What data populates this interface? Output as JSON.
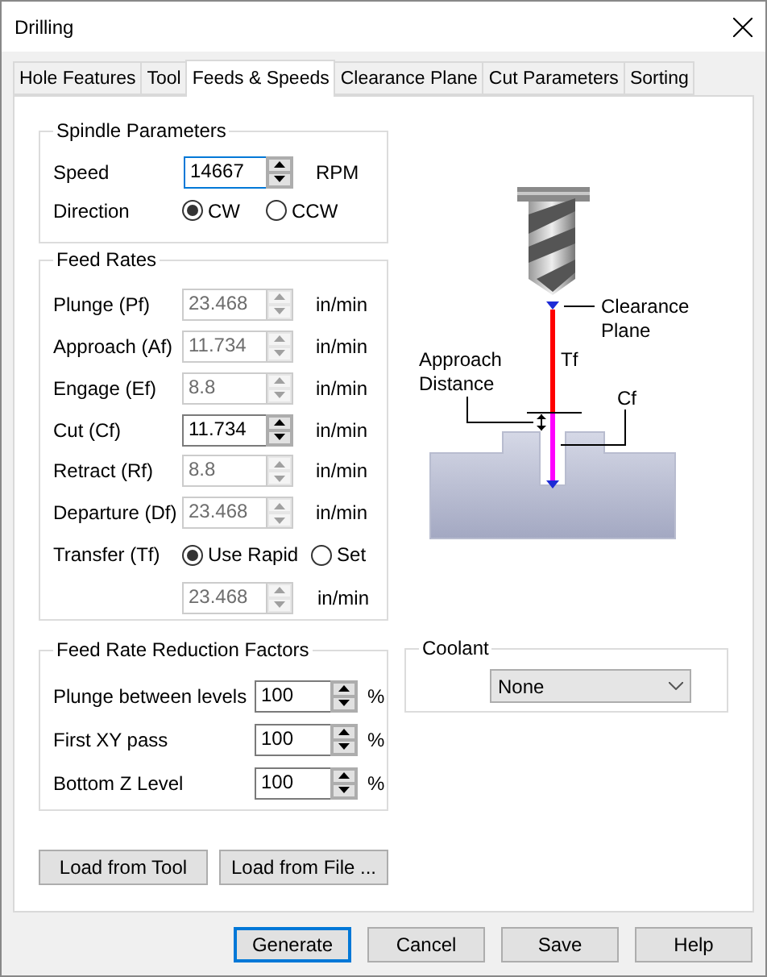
{
  "window": {
    "title": "Drilling"
  },
  "tabs": [
    {
      "label": "Hole Features",
      "selected": false
    },
    {
      "label": "Tool",
      "selected": false
    },
    {
      "label": "Feeds & Speeds",
      "selected": true
    },
    {
      "label": "Clearance Plane",
      "selected": false
    },
    {
      "label": "Cut Parameters",
      "selected": false
    },
    {
      "label": "Sorting",
      "selected": false
    }
  ],
  "spindle": {
    "title": "Spindle Parameters",
    "speed_label": "Speed",
    "speed": "14667",
    "speed_focused": true,
    "speed_unit": "RPM",
    "direction_label": "Direction",
    "directions": [
      {
        "label": "CW",
        "selected": true
      },
      {
        "label": "CCW",
        "selected": false
      }
    ]
  },
  "feed_rates": {
    "title": "Feed Rates",
    "rows": [
      {
        "label": "Plunge (Pf)",
        "value": "23.468",
        "unit": "in/min",
        "disabled": true
      },
      {
        "label": "Approach (Af)",
        "value": "11.734",
        "unit": "in/min",
        "disabled": true
      },
      {
        "label": "Engage (Ef)",
        "value": "8.8",
        "unit": "in/min",
        "disabled": true
      },
      {
        "label": "Cut (Cf)",
        "value": "11.734",
        "unit": "in/min",
        "disabled": false
      },
      {
        "label": "Retract (Rf)",
        "value": "8.8",
        "unit": "in/min",
        "disabled": true
      },
      {
        "label": "Departure  (Df)",
        "value": "23.468",
        "unit": "in/min",
        "disabled": true
      }
    ],
    "transfer": {
      "label": "Transfer (Tf)",
      "options": [
        {
          "label": "Use Rapid",
          "selected": true
        },
        {
          "label": "Set",
          "selected": false
        }
      ],
      "value": "23.468",
      "unit": "in/min",
      "disabled": true
    }
  },
  "reduction": {
    "title": "Feed Rate Reduction Factors",
    "rows": [
      {
        "label": "Plunge between levels",
        "value": "100",
        "unit": "%"
      },
      {
        "label": "First XY pass",
        "value": "100",
        "unit": "%"
      },
      {
        "label": "Bottom Z Level",
        "value": "100",
        "unit": "%"
      }
    ]
  },
  "load_buttons": [
    "Load from Tool",
    "Load from File ..."
  ],
  "diagram": {
    "clearance_label": [
      "Clearance",
      "Plane"
    ],
    "tf_label": "Tf",
    "approach_label": [
      "Approach",
      "Distance"
    ],
    "cf_label": "Cf"
  },
  "coolant": {
    "title": "Coolant",
    "value": "None"
  },
  "buttons": [
    {
      "label": "Generate",
      "default": true
    },
    {
      "label": "Cancel",
      "default": false
    },
    {
      "label": "Save",
      "default": false
    },
    {
      "label": "Help",
      "default": false
    }
  ]
}
